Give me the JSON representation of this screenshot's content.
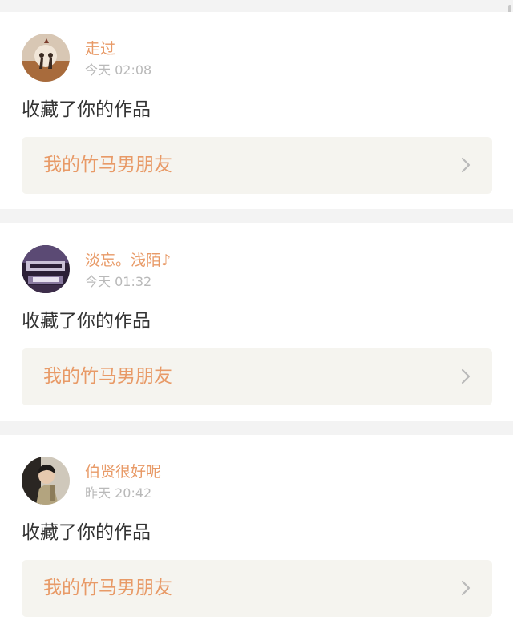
{
  "notifications": [
    {
      "username": "走过",
      "time": "今天 02:08",
      "action": "收藏了你的作品",
      "work_title": "我的竹马男朋友",
      "avatar_icon": "silhouette-couple-avatar"
    },
    {
      "username": "淡忘。浅陌♪",
      "time": "今天 01:32",
      "action": "收藏了你的作品",
      "work_title": "我的竹马男朋友",
      "avatar_icon": "purple-photo-avatar"
    },
    {
      "username": "伯贤很好呢",
      "time": "昨天 20:42",
      "action": "收藏了你的作品",
      "work_title": "我的竹马男朋友",
      "avatar_icon": "person-photo-avatar"
    }
  ],
  "colors": {
    "accent": "#e89a67",
    "background": "#f3f3f3",
    "card": "#ffffff",
    "work_box": "#f5f4ef",
    "text": "#333333",
    "muted": "#b9b9b9"
  }
}
